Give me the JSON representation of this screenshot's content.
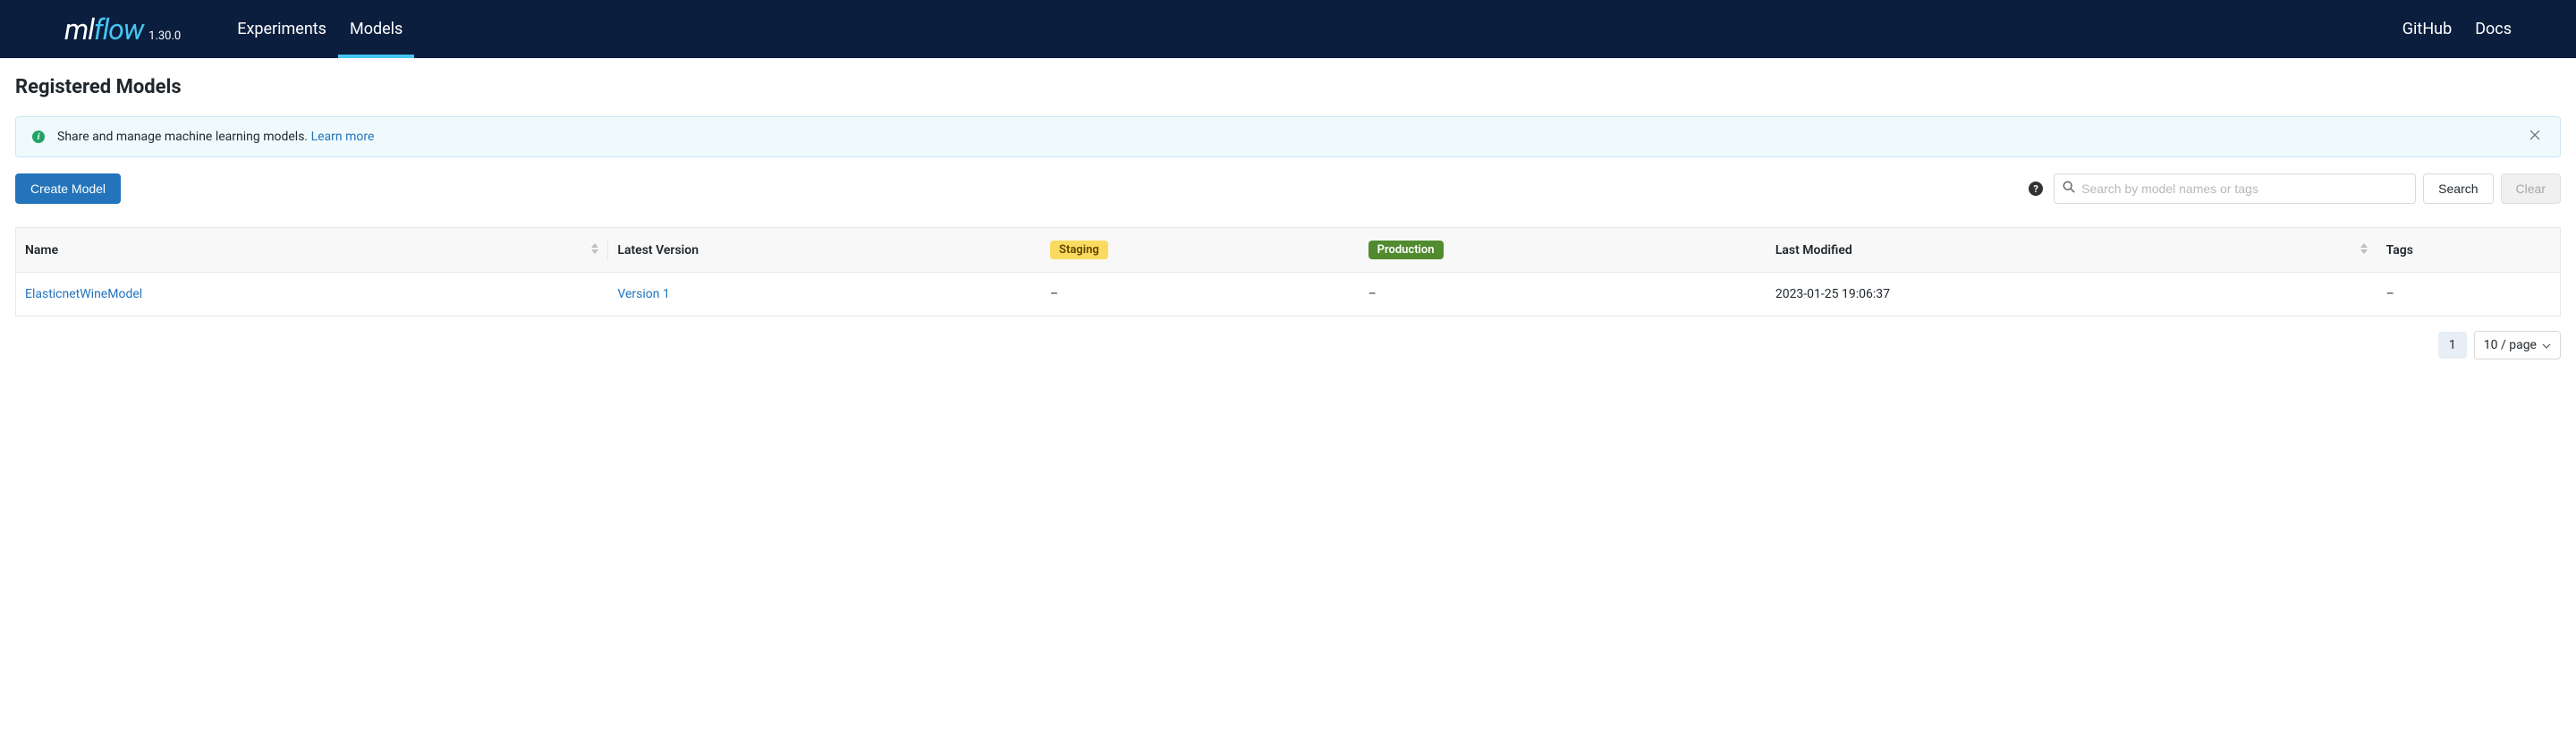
{
  "header": {
    "logo_ml": "ml",
    "logo_flow": "flow",
    "version": "1.30.0",
    "nav": [
      {
        "label": "Experiments",
        "active": false
      },
      {
        "label": "Models",
        "active": true
      }
    ],
    "right_links": [
      {
        "label": "GitHub"
      },
      {
        "label": "Docs"
      }
    ]
  },
  "page_title": "Registered Models",
  "banner": {
    "text": "Share and manage machine learning models. ",
    "link_text": "Learn more"
  },
  "toolbar": {
    "create_label": "Create Model",
    "search_placeholder": "Search by model names or tags",
    "search_label": "Search",
    "clear_label": "Clear"
  },
  "columns": {
    "name": "Name",
    "latest_version": "Latest Version",
    "staging": "Staging",
    "production": "Production",
    "last_modified": "Last Modified",
    "tags": "Tags"
  },
  "rows": [
    {
      "name": "ElasticnetWineModel",
      "latest_version": "Version 1",
      "staging": "–",
      "production": "–",
      "last_modified": "2023-01-25 19:06:37",
      "tags": "–"
    }
  ],
  "pagination": {
    "current_page": "1",
    "page_size": "10 / page"
  }
}
